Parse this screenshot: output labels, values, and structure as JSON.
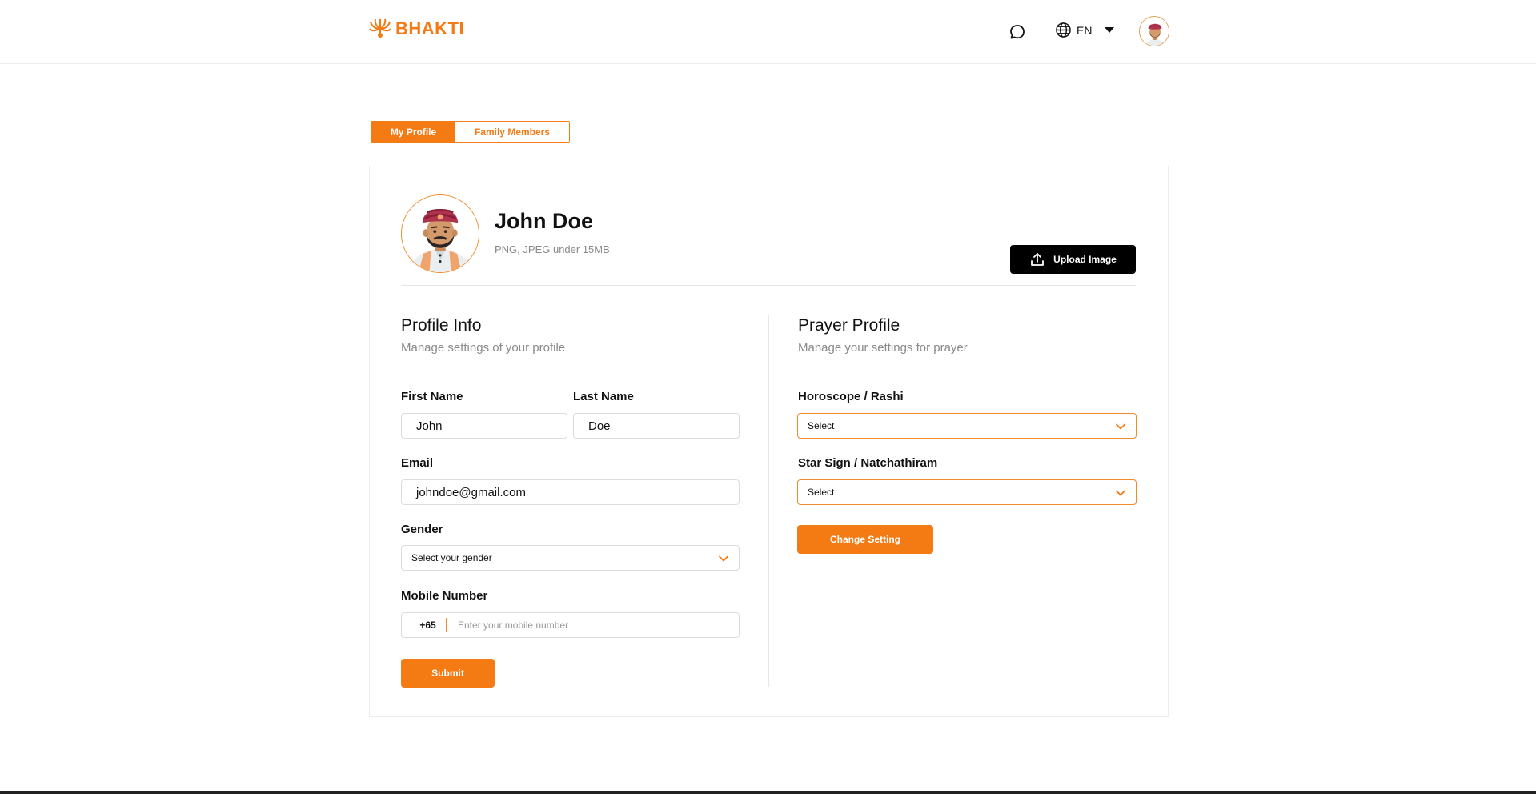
{
  "brand": {
    "name": "BHAKTI",
    "color": "#f47a14"
  },
  "header": {
    "chat_icon": "chat-bubble-icon",
    "language": "EN",
    "globe_icon": "globe-icon"
  },
  "tabs": [
    {
      "label": "My Profile",
      "active": true
    },
    {
      "label": "Family Members",
      "active": false
    }
  ],
  "profile": {
    "name": "John Doe",
    "upload_hint": "PNG, JPEG under 15MB",
    "upload_button": "Upload Image"
  },
  "profile_info": {
    "title": "Profile Info",
    "subtitle": "Manage settings of your profile",
    "first_name_label": "First Name",
    "first_name_value": "John",
    "last_name_label": "Last Name",
    "last_name_value": "Doe",
    "email_label": "Email",
    "email_value": "johndoe@gmail.com",
    "gender_label": "Gender",
    "gender_value": "Select your gender",
    "mobile_label": "Mobile Number",
    "mobile_code": "+65",
    "mobile_placeholder": "Enter your mobile number",
    "submit_label": "Submit"
  },
  "prayer_profile": {
    "title": "Prayer Profile",
    "subtitle": "Manage your settings for prayer",
    "horoscope_label": "Horoscope / Rashi",
    "horoscope_value": "Select",
    "star_label": "Star Sign / Natchathiram",
    "star_value": "Select",
    "change_label": "Change Setting"
  },
  "colors": {
    "accent": "#f47a14",
    "dark": "#000000",
    "muted": "#8a8a8a"
  }
}
